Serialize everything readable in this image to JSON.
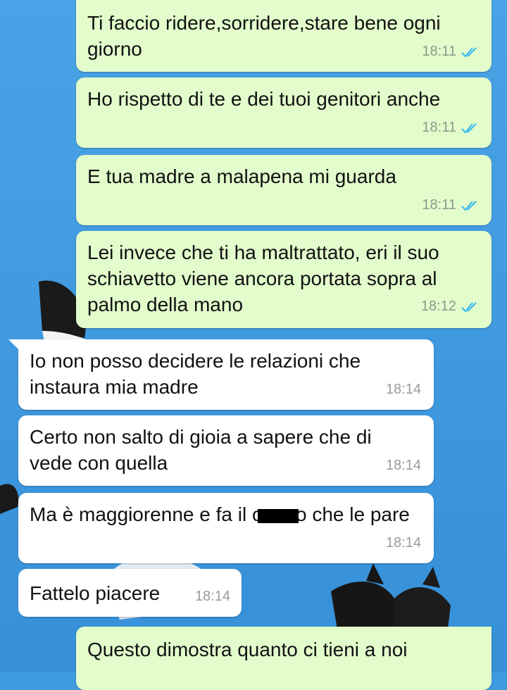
{
  "messages": [
    {
      "direction": "out",
      "text": "Ti faccio ridere,sorridere,stare bene ogni giorno",
      "time": "18:11",
      "status": "read"
    },
    {
      "direction": "out",
      "text": "Ho rispetto di te e dei tuoi genitori anche",
      "time": "18:11",
      "status": "read"
    },
    {
      "direction": "out",
      "text": "E tua madre a malapena mi guarda",
      "time": "18:11",
      "status": "read"
    },
    {
      "direction": "out",
      "text": "Lei invece che ti ha maltrattato, eri il suo schiavetto viene ancora portata sopra al palmo della mano",
      "time": "18:12",
      "status": "read"
    },
    {
      "direction": "in",
      "text": "Io non posso decidere le relazioni che instaura mia madre",
      "time": "18:14"
    },
    {
      "direction": "in",
      "text": "Certo non salto di gioia a sapere che di vede con quella",
      "time": "18:14"
    },
    {
      "direction": "in",
      "text_before": "Ma è maggiorenne e fa il c",
      "text_after": "o che le pare",
      "time": "18:14",
      "redacted": true
    },
    {
      "direction": "in",
      "text": "Fattelo piacere",
      "time": "18:14"
    },
    {
      "direction": "out",
      "text": "Questo dimostra quanto ci tieni a noi",
      "time": ""
    }
  ],
  "colors": {
    "outgoing_bubble": "#e2fccc",
    "incoming_bubble": "#ffffff",
    "read_ticks": "#34b7f1",
    "wallpaper": "#3f9be0"
  }
}
